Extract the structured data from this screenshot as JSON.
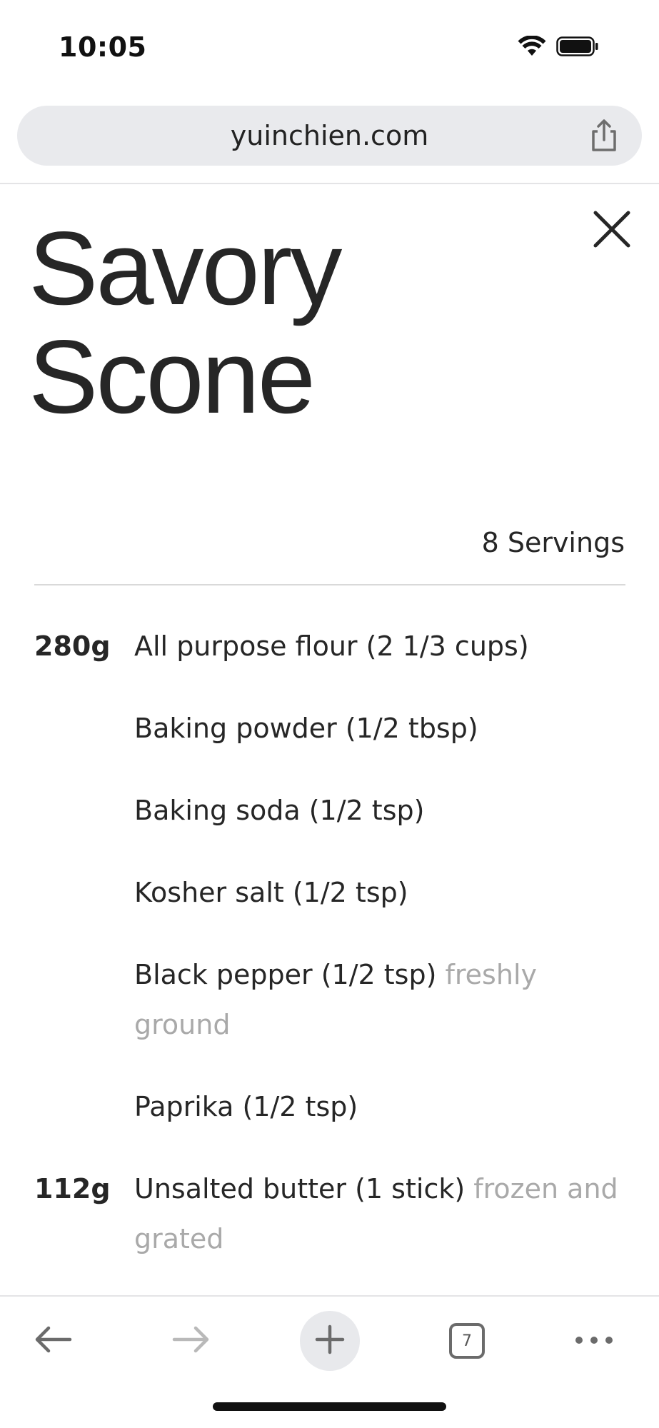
{
  "status_bar": {
    "time": "10:05"
  },
  "browser": {
    "url": "yuinchien.com",
    "tabs_count": "7"
  },
  "recipe": {
    "title_line1": "Savory",
    "title_line2": "Scone",
    "servings": "8 Servings",
    "ingredients": [
      {
        "amount": "280g",
        "text": "All purpose flour (2 1/3 cups)",
        "note": ""
      },
      {
        "amount": "",
        "text": "Baking powder (1/2 tbsp)",
        "note": ""
      },
      {
        "amount": "",
        "text": "Baking soda (1/2 tsp)",
        "note": ""
      },
      {
        "amount": "",
        "text": "Kosher salt (1/2 tsp)",
        "note": ""
      },
      {
        "amount": "",
        "text": "Black pepper (1/2 tsp)",
        "note": "freshly ground"
      },
      {
        "amount": "",
        "text": "Paprika (1/2 tsp)",
        "note": ""
      },
      {
        "amount": "112g",
        "text": "Unsalted butter (1 stick)",
        "note": "frozen and grated"
      }
    ]
  },
  "icons": {
    "status": [
      "wifi-icon",
      "battery-icon"
    ],
    "address_bar": [
      "share-icon"
    ],
    "page": [
      "close-icon"
    ],
    "toolbar": [
      "back-arrow-icon",
      "forward-arrow-icon",
      "plus-icon",
      "tabs-icon",
      "more-icon"
    ]
  },
  "colors": {
    "text": "#262626",
    "note_text": "#a9a9a9",
    "address_bar_bg": "#e9eaed",
    "divider": "#d9d9d9"
  }
}
